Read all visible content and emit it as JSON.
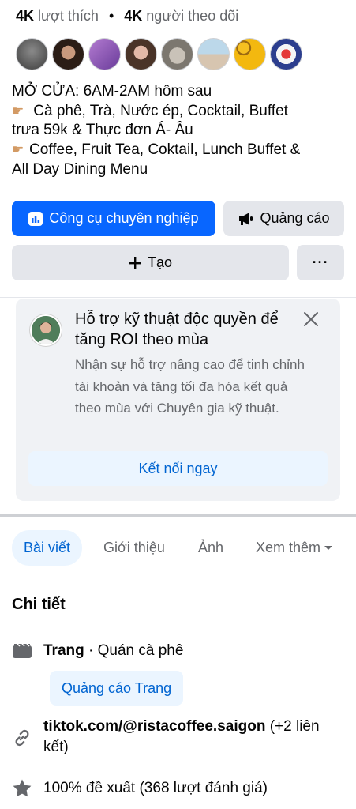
{
  "stats": {
    "likes_count": "4K",
    "likes_label": "lượt thích",
    "separator": "•",
    "followers_count": "4K",
    "followers_label": "người theo dõi"
  },
  "bio": {
    "line1": "MỞ CỬA: 6AM-2AM hôm sau",
    "line2": "Cà phê, Trà, Nước ép, Cocktail, Buffet",
    "line3": "trưa 59k & Thực đơn Á- Âu",
    "line4": "Coffee, Fruit Tea, Coktail, Lunch Buffet &",
    "line5": "All Day Dining Menu",
    "hand_glyph": "👉🏼"
  },
  "actions": {
    "professional_tools": "Công cụ chuyên nghiệp",
    "advertise": "Quảng cáo",
    "create": "Tạo",
    "more": "···"
  },
  "promo": {
    "title": "Hỗ trợ kỹ thuật độc quyền để tăng ROI theo mùa",
    "body": "Nhận sự hỗ trợ nâng cao để tinh chỉnh tài khoản và tăng tối đa hóa kết quả theo mùa với Chuyên gia kỹ thuật.",
    "cta": "Kết nối ngay"
  },
  "tabs": {
    "posts": "Bài viết",
    "about": "Giới thiệu",
    "photos": "Ảnh",
    "more": "Xem thêm"
  },
  "details": {
    "title": "Chi tiết",
    "page_label": "Trang",
    "page_category": " · Quán cà phê",
    "promote_page": "Quảng cáo Trang",
    "link_text": "tiktok.com/@ristacoffee.saigon",
    "link_extra": " (+2 liên kết)",
    "rating": "100% đề xuất (368 lượt đánh giá)"
  },
  "colors": {
    "accent": "#0866ff",
    "accent_text": "#0064d1",
    "secondary_bg": "#e4e6eb"
  }
}
